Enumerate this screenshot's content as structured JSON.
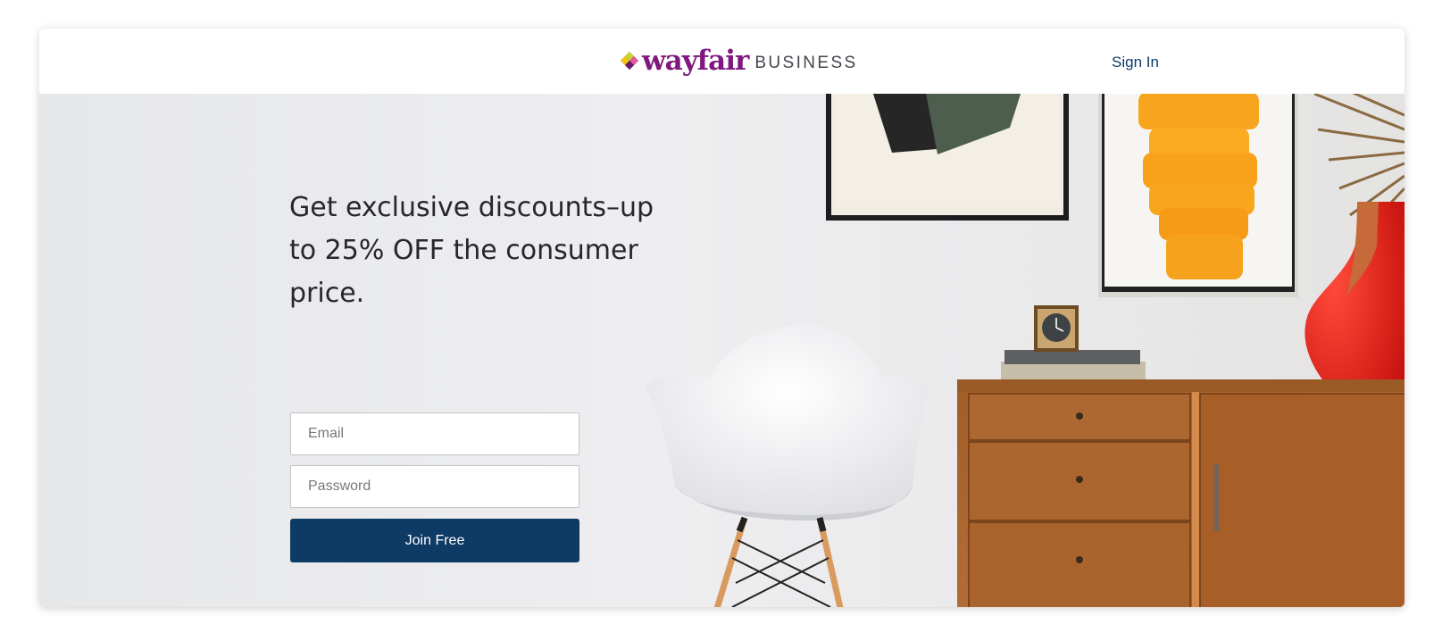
{
  "header": {
    "logo_word": "wayfair",
    "logo_suffix": "BUSINESS",
    "signin_label": "Sign In"
  },
  "hero": {
    "headline": "Get exclusive discounts–up to 25% OFF the consumer price."
  },
  "form": {
    "email_placeholder": "Email",
    "password_placeholder": "Password",
    "submit_label": "Join Free"
  },
  "colors": {
    "brand_purple": "#7f187f",
    "button_navy": "#0e3a66",
    "link_navy": "#0f3a68"
  },
  "icons": [
    "wayfair-logo-mark-icon",
    "analog-clock-icon"
  ]
}
